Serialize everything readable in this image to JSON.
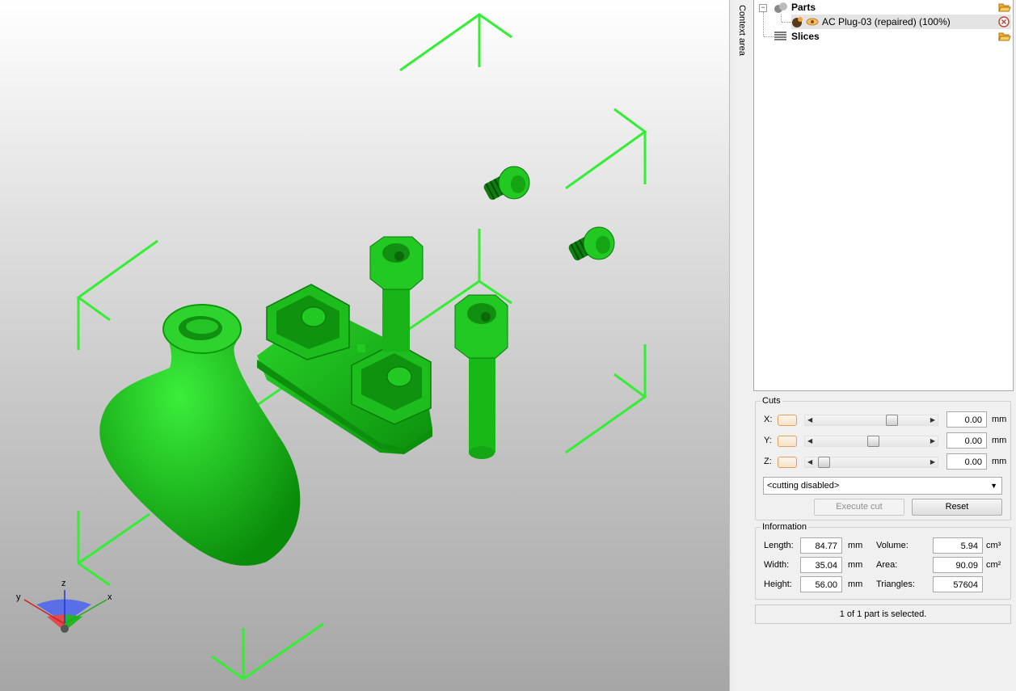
{
  "tree": {
    "parts_label": "Parts",
    "part_name": "AC Plug-03 (repaired) (100%)",
    "slices_label": "Slices"
  },
  "context_area_label": "Context area",
  "cuts": {
    "title": "Cuts",
    "axes": [
      {
        "label": "X:",
        "value": "0.00",
        "unit": "mm",
        "slider_fraction": 0.67
      },
      {
        "label": "Y:",
        "value": "0.00",
        "unit": "mm",
        "slider_fraction": 0.49
      },
      {
        "label": "Z:",
        "value": "0.00",
        "unit": "mm",
        "slider_fraction": 0.0
      }
    ],
    "mode_selected": "<cutting disabled>",
    "execute_label": "Execute cut",
    "reset_label": "Reset"
  },
  "information": {
    "title": "Information",
    "length_label": "Length:",
    "length_value": "84.77",
    "length_unit": "mm",
    "width_label": "Width:",
    "width_value": "35.04",
    "width_unit": "mm",
    "height_label": "Height:",
    "height_value": "56.00",
    "height_unit": "mm",
    "volume_label": "Volume:",
    "volume_value": "5.94",
    "volume_unit": "cm³",
    "area_label": "Area:",
    "area_value": "90.09",
    "area_unit": "cm²",
    "triangles_label": "Triangles:",
    "triangles_value": "57604"
  },
  "status_text": "1 of 1 part is selected.",
  "axis_indicator": {
    "x": "x",
    "y": "y",
    "z": "z"
  },
  "colors": {
    "model_green": "#22cc22",
    "bounding_box": "#33ee33"
  }
}
